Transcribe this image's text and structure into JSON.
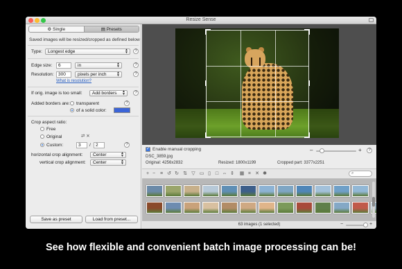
{
  "window": {
    "title": "Resize Sense"
  },
  "tabs": [
    {
      "label": "Single",
      "icon": "gear-icon",
      "active": false
    },
    {
      "label": "Presets",
      "icon": "list-icon",
      "active": true
    }
  ],
  "left": {
    "info_text": "Saved images will be resized/cropped as defined below",
    "type": {
      "label": "Type:",
      "value": "Longest edge"
    },
    "edge_size": {
      "label": "Edge size:",
      "value": "6",
      "unit": "in"
    },
    "resolution": {
      "label": "Resolution:",
      "value": "300",
      "unit": "pixels per inch",
      "link": "What is resolution?"
    },
    "small": {
      "label": "If orig. image is too small:",
      "value": "Add borders"
    },
    "borders": {
      "label": "Added borders are:",
      "option_transparent": "transparent",
      "option_solid": "of a solid color:",
      "selected": "solid",
      "color": "#3b64d8"
    },
    "crop": {
      "label": "Crop aspect ratio:",
      "free": "Free",
      "original": "Original",
      "custom": "Custom:",
      "selected": "custom",
      "ratio_a": "3",
      "ratio_sep": "/",
      "ratio_b": "2",
      "h_align_label": "horizontal crop alignment:",
      "h_align_value": "Center",
      "v_align_label": "vertical crop alignment:",
      "v_align_value": "Center"
    },
    "save_preset": "Save as preset",
    "load_preset": "Load from preset..."
  },
  "cropbar": {
    "manual_label": "Enable manual cropping",
    "manual_checked": true,
    "filename": "DSC_3859.jpg",
    "original": "Original: 4256x2832",
    "resized": "Resized: 1800x1199",
    "cropped": "Cropped part: 3377x2251",
    "zoom_minus": "–",
    "zoom_plus": "+"
  },
  "toolbar": {
    "search_placeholder": ""
  },
  "thumbnails": {
    "colors": [
      "#6b8aa8",
      "#9aa56a",
      "#c7b08a",
      "#b7c9d8",
      "#5f8fb5",
      "#3d5f8a",
      "#8db3d4",
      "#7fa6c4",
      "#4f86b8",
      "#a3c1da",
      "#6fa0c8",
      "#92b8d6",
      "#5a7ea3",
      "#8a4a2a",
      "#6d8cb0",
      "#c9a27a",
      "#d8c0a0",
      "#b28c66",
      "#cfa983",
      "#e0b58a",
      "#7c9a5a",
      "#a84a3a",
      "#5f7f4a",
      "#84a8c6",
      "#c05a4a",
      "#9ab0c0",
      "#7090b0"
    ]
  },
  "status": {
    "count": "63 images (1 selected)"
  },
  "caption": "See how flexible and convenient batch image processing can be!"
}
